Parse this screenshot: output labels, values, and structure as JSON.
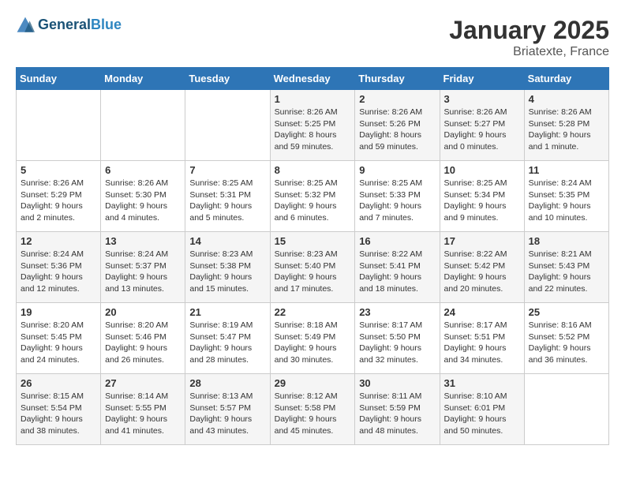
{
  "header": {
    "logo_general": "General",
    "logo_blue": "Blue",
    "month_title": "January 2025",
    "location": "Briatexte, France"
  },
  "days_of_week": [
    "Sunday",
    "Monday",
    "Tuesday",
    "Wednesday",
    "Thursday",
    "Friday",
    "Saturday"
  ],
  "weeks": [
    [
      {
        "day": "",
        "sunrise": "",
        "sunset": "",
        "daylight": ""
      },
      {
        "day": "",
        "sunrise": "",
        "sunset": "",
        "daylight": ""
      },
      {
        "day": "",
        "sunrise": "",
        "sunset": "",
        "daylight": ""
      },
      {
        "day": "1",
        "sunrise": "Sunrise: 8:26 AM",
        "sunset": "Sunset: 5:25 PM",
        "daylight": "Daylight: 8 hours and 59 minutes."
      },
      {
        "day": "2",
        "sunrise": "Sunrise: 8:26 AM",
        "sunset": "Sunset: 5:26 PM",
        "daylight": "Daylight: 8 hours and 59 minutes."
      },
      {
        "day": "3",
        "sunrise": "Sunrise: 8:26 AM",
        "sunset": "Sunset: 5:27 PM",
        "daylight": "Daylight: 9 hours and 0 minutes."
      },
      {
        "day": "4",
        "sunrise": "Sunrise: 8:26 AM",
        "sunset": "Sunset: 5:28 PM",
        "daylight": "Daylight: 9 hours and 1 minute."
      }
    ],
    [
      {
        "day": "5",
        "sunrise": "Sunrise: 8:26 AM",
        "sunset": "Sunset: 5:29 PM",
        "daylight": "Daylight: 9 hours and 2 minutes."
      },
      {
        "day": "6",
        "sunrise": "Sunrise: 8:26 AM",
        "sunset": "Sunset: 5:30 PM",
        "daylight": "Daylight: 9 hours and 4 minutes."
      },
      {
        "day": "7",
        "sunrise": "Sunrise: 8:25 AM",
        "sunset": "Sunset: 5:31 PM",
        "daylight": "Daylight: 9 hours and 5 minutes."
      },
      {
        "day": "8",
        "sunrise": "Sunrise: 8:25 AM",
        "sunset": "Sunset: 5:32 PM",
        "daylight": "Daylight: 9 hours and 6 minutes."
      },
      {
        "day": "9",
        "sunrise": "Sunrise: 8:25 AM",
        "sunset": "Sunset: 5:33 PM",
        "daylight": "Daylight: 9 hours and 7 minutes."
      },
      {
        "day": "10",
        "sunrise": "Sunrise: 8:25 AM",
        "sunset": "Sunset: 5:34 PM",
        "daylight": "Daylight: 9 hours and 9 minutes."
      },
      {
        "day": "11",
        "sunrise": "Sunrise: 8:24 AM",
        "sunset": "Sunset: 5:35 PM",
        "daylight": "Daylight: 9 hours and 10 minutes."
      }
    ],
    [
      {
        "day": "12",
        "sunrise": "Sunrise: 8:24 AM",
        "sunset": "Sunset: 5:36 PM",
        "daylight": "Daylight: 9 hours and 12 minutes."
      },
      {
        "day": "13",
        "sunrise": "Sunrise: 8:24 AM",
        "sunset": "Sunset: 5:37 PM",
        "daylight": "Daylight: 9 hours and 13 minutes."
      },
      {
        "day": "14",
        "sunrise": "Sunrise: 8:23 AM",
        "sunset": "Sunset: 5:38 PM",
        "daylight": "Daylight: 9 hours and 15 minutes."
      },
      {
        "day": "15",
        "sunrise": "Sunrise: 8:23 AM",
        "sunset": "Sunset: 5:40 PM",
        "daylight": "Daylight: 9 hours and 17 minutes."
      },
      {
        "day": "16",
        "sunrise": "Sunrise: 8:22 AM",
        "sunset": "Sunset: 5:41 PM",
        "daylight": "Daylight: 9 hours and 18 minutes."
      },
      {
        "day": "17",
        "sunrise": "Sunrise: 8:22 AM",
        "sunset": "Sunset: 5:42 PM",
        "daylight": "Daylight: 9 hours and 20 minutes."
      },
      {
        "day": "18",
        "sunrise": "Sunrise: 8:21 AM",
        "sunset": "Sunset: 5:43 PM",
        "daylight": "Daylight: 9 hours and 22 minutes."
      }
    ],
    [
      {
        "day": "19",
        "sunrise": "Sunrise: 8:20 AM",
        "sunset": "Sunset: 5:45 PM",
        "daylight": "Daylight: 9 hours and 24 minutes."
      },
      {
        "day": "20",
        "sunrise": "Sunrise: 8:20 AM",
        "sunset": "Sunset: 5:46 PM",
        "daylight": "Daylight: 9 hours and 26 minutes."
      },
      {
        "day": "21",
        "sunrise": "Sunrise: 8:19 AM",
        "sunset": "Sunset: 5:47 PM",
        "daylight": "Daylight: 9 hours and 28 minutes."
      },
      {
        "day": "22",
        "sunrise": "Sunrise: 8:18 AM",
        "sunset": "Sunset: 5:49 PM",
        "daylight": "Daylight: 9 hours and 30 minutes."
      },
      {
        "day": "23",
        "sunrise": "Sunrise: 8:17 AM",
        "sunset": "Sunset: 5:50 PM",
        "daylight": "Daylight: 9 hours and 32 minutes."
      },
      {
        "day": "24",
        "sunrise": "Sunrise: 8:17 AM",
        "sunset": "Sunset: 5:51 PM",
        "daylight": "Daylight: 9 hours and 34 minutes."
      },
      {
        "day": "25",
        "sunrise": "Sunrise: 8:16 AM",
        "sunset": "Sunset: 5:52 PM",
        "daylight": "Daylight: 9 hours and 36 minutes."
      }
    ],
    [
      {
        "day": "26",
        "sunrise": "Sunrise: 8:15 AM",
        "sunset": "Sunset: 5:54 PM",
        "daylight": "Daylight: 9 hours and 38 minutes."
      },
      {
        "day": "27",
        "sunrise": "Sunrise: 8:14 AM",
        "sunset": "Sunset: 5:55 PM",
        "daylight": "Daylight: 9 hours and 41 minutes."
      },
      {
        "day": "28",
        "sunrise": "Sunrise: 8:13 AM",
        "sunset": "Sunset: 5:57 PM",
        "daylight": "Daylight: 9 hours and 43 minutes."
      },
      {
        "day": "29",
        "sunrise": "Sunrise: 8:12 AM",
        "sunset": "Sunset: 5:58 PM",
        "daylight": "Daylight: 9 hours and 45 minutes."
      },
      {
        "day": "30",
        "sunrise": "Sunrise: 8:11 AM",
        "sunset": "Sunset: 5:59 PM",
        "daylight": "Daylight: 9 hours and 48 minutes."
      },
      {
        "day": "31",
        "sunrise": "Sunrise: 8:10 AM",
        "sunset": "Sunset: 6:01 PM",
        "daylight": "Daylight: 9 hours and 50 minutes."
      },
      {
        "day": "",
        "sunrise": "",
        "sunset": "",
        "daylight": ""
      }
    ]
  ]
}
